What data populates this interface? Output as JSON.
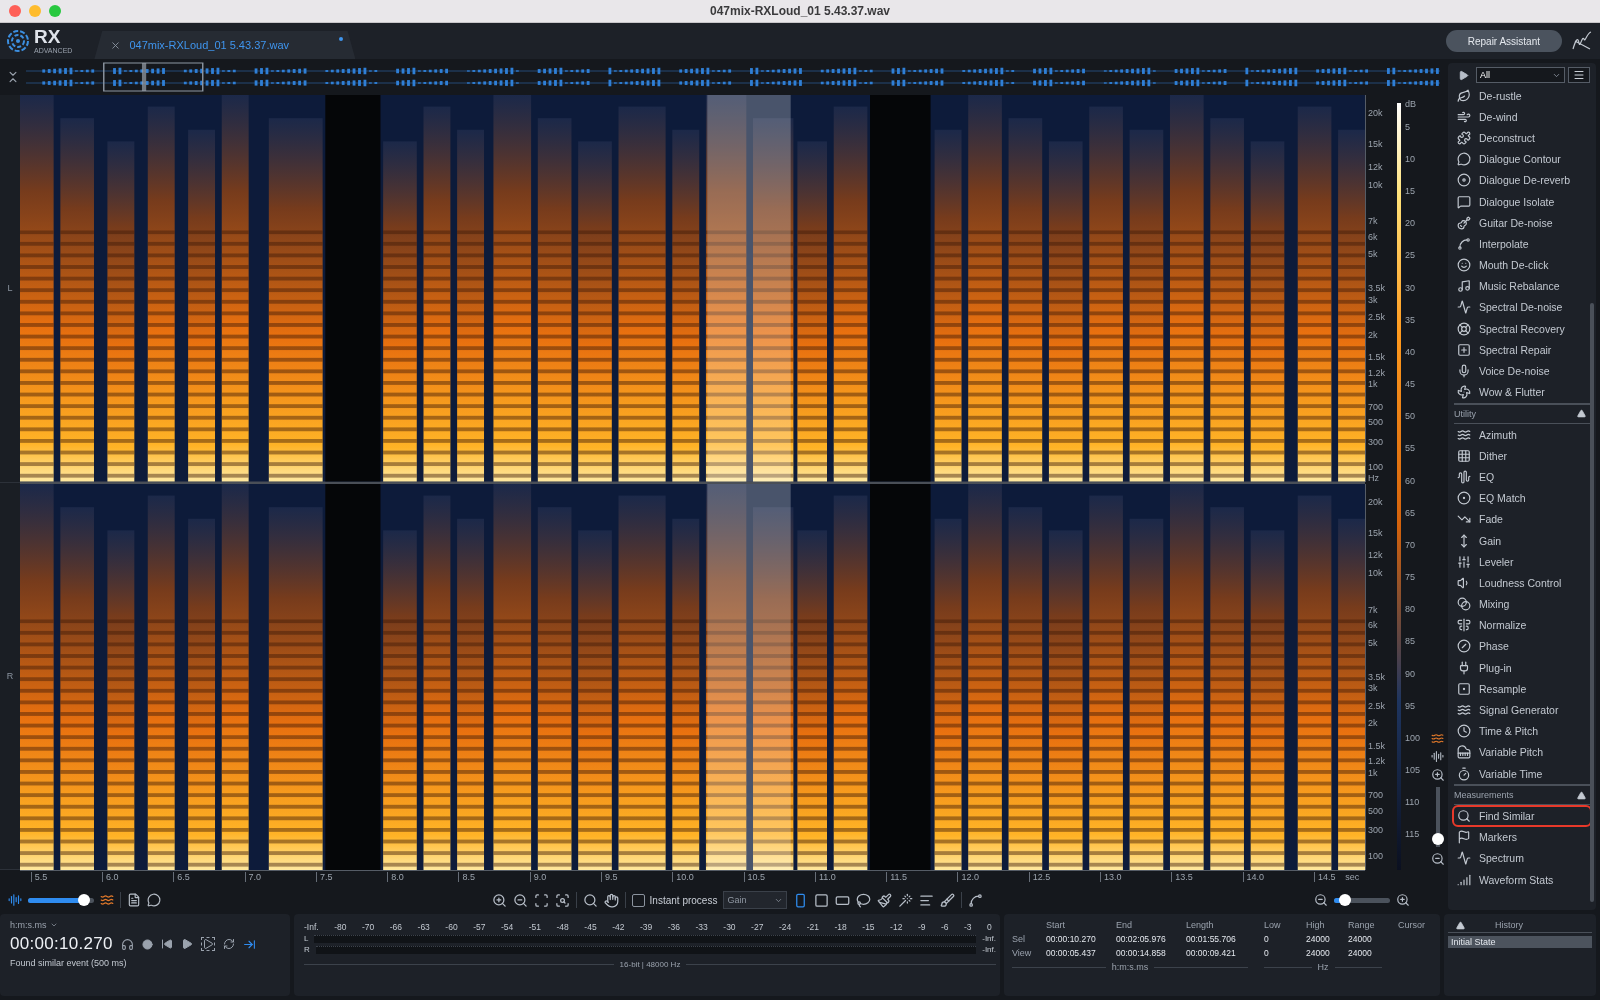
{
  "window": {
    "title": "047mix-RXLoud_01 5.43.37.wav"
  },
  "header": {
    "logo": "RX",
    "logo_sub": "ADVANCED",
    "tab": {
      "label": "047mix-RXLoud_01 5.43.37.wav",
      "modified": true
    },
    "repair_button": "Repair Assistant"
  },
  "spectrogram": {
    "channels": [
      {
        "label": "L",
        "freq_labels": [
          "20k",
          "15k",
          "12k",
          "10k",
          "7k",
          "6k",
          "5k",
          "3.5k",
          "3k",
          "2.5k",
          "2k",
          "1.5k",
          "1.2k",
          "1k",
          "700",
          "500",
          "300",
          "100",
          "Hz"
        ]
      },
      {
        "label": "R",
        "freq_labels": [
          "20k",
          "15k",
          "12k",
          "10k",
          "7k",
          "6k",
          "5k",
          "3.5k",
          "3k",
          "2.5k",
          "2k",
          "1.5k",
          "1.2k",
          "1k",
          "700",
          "500",
          "300",
          "100"
        ]
      }
    ],
    "db_labels": [
      "dB",
      "5",
      "10",
      "15",
      "20",
      "25",
      "30",
      "35",
      "40",
      "45",
      "50",
      "55",
      "60",
      "65",
      "70",
      "75",
      "80",
      "85",
      "90",
      "95",
      "100",
      "105",
      "110",
      "115"
    ],
    "time_labels": [
      "5.5",
      "6.0",
      "6.5",
      "7.0",
      "7.5",
      "8.0",
      "8.5",
      "9.0",
      "9.5",
      "10.0",
      "10.5",
      "11.0",
      "11.5",
      "12.0",
      "12.5",
      "13.0",
      "13.5",
      "14.0",
      "14.5"
    ],
    "time_unit": "sec"
  },
  "vertical_zoom": {
    "level": 0.05
  },
  "toolbar": {
    "blend": {
      "level": 0.85
    },
    "instant_process": {
      "label": "Instant process",
      "checked": false
    },
    "process": {
      "value": "Gain"
    },
    "horizontal_zoom": {
      "level": 0.2
    }
  },
  "modules": {
    "filter": "All",
    "groups": [
      {
        "items": [
          {
            "label": "De-rustle",
            "highlighted": false
          },
          {
            "label": "De-wind",
            "highlighted": false
          },
          {
            "label": "Deconstruct",
            "highlighted": false
          },
          {
            "label": "Dialogue Contour",
            "highlighted": false
          },
          {
            "label": "Dialogue De-reverb",
            "highlighted": false
          },
          {
            "label": "Dialogue Isolate",
            "highlighted": false
          },
          {
            "label": "Guitar De-noise",
            "highlighted": false
          },
          {
            "label": "Interpolate",
            "highlighted": false
          },
          {
            "label": "Mouth De-click",
            "highlighted": false
          },
          {
            "label": "Music Rebalance",
            "highlighted": false
          },
          {
            "label": "Spectral De-noise",
            "highlighted": false
          },
          {
            "label": "Spectral Recovery",
            "highlighted": false
          },
          {
            "label": "Spectral Repair",
            "highlighted": false
          },
          {
            "label": "Voice De-noise",
            "highlighted": false
          },
          {
            "label": "Wow & Flutter",
            "highlighted": false
          }
        ]
      },
      {
        "title": "Utility",
        "expanded": true,
        "items": [
          {
            "label": "Azimuth",
            "highlighted": false
          },
          {
            "label": "Dither",
            "highlighted": false
          },
          {
            "label": "EQ",
            "highlighted": false
          },
          {
            "label": "EQ Match",
            "highlighted": false
          },
          {
            "label": "Fade",
            "highlighted": false
          },
          {
            "label": "Gain",
            "highlighted": false
          },
          {
            "label": "Leveler",
            "highlighted": false
          },
          {
            "label": "Loudness Control",
            "highlighted": false
          },
          {
            "label": "Mixing",
            "highlighted": false
          },
          {
            "label": "Normalize",
            "highlighted": false
          },
          {
            "label": "Phase",
            "highlighted": false
          },
          {
            "label": "Plug-in",
            "highlighted": false
          },
          {
            "label": "Resample",
            "highlighted": false
          },
          {
            "label": "Signal Generator",
            "highlighted": false
          },
          {
            "label": "Time & Pitch",
            "highlighted": false
          },
          {
            "label": "Variable Pitch",
            "highlighted": false
          },
          {
            "label": "Variable Time",
            "highlighted": false
          }
        ]
      },
      {
        "title": "Measurements",
        "expanded": true,
        "items": [
          {
            "label": "Find Similar",
            "highlighted": true
          },
          {
            "label": "Markers",
            "highlighted": false
          },
          {
            "label": "Spectrum",
            "highlighted": false
          },
          {
            "label": "Waveform Stats",
            "highlighted": false
          }
        ]
      }
    ]
  },
  "transport": {
    "time_format": "h:m:s.ms",
    "time": "00:00:10.270",
    "follow": {
      "on": true
    },
    "status": "Found similar event (500 ms)"
  },
  "meter": {
    "scale": [
      "-Inf.",
      "-80",
      "-70",
      "-66",
      "-63",
      "-60",
      "-57",
      "-54",
      "-51",
      "-48",
      "-45",
      "-42",
      "-39",
      "-36",
      "-33",
      "-30",
      "-27",
      "-24",
      "-21",
      "-18",
      "-15",
      "-12",
      "-9",
      "-6",
      "-3",
      "0"
    ],
    "channels": [
      {
        "label": "L",
        "peak": "-Inf."
      },
      {
        "label": "R",
        "peak": "-Inf."
      }
    ],
    "format": "16-bit | 48000 Hz"
  },
  "selection_info": {
    "time_headers": [
      "Start",
      "End",
      "Length"
    ],
    "freq_headers": [
      "Low",
      "High",
      "Range"
    ],
    "cursor_header": "Cursor",
    "rows": [
      {
        "label": "Sel",
        "times": [
          "00:00:10.270",
          "00:02:05.976",
          "00:01:55.706"
        ],
        "freqs": [
          "0",
          "24000",
          "24000"
        ]
      },
      {
        "label": "View",
        "times": [
          "00:00:05.437",
          "00:00:14.858",
          "00:00:09.421"
        ],
        "freqs": [
          "0",
          "24000",
          "24000"
        ]
      }
    ],
    "time_unit": "h:m:s.ms",
    "freq_unit": "Hz"
  },
  "history": {
    "title": "History",
    "items": [
      {
        "label": "Initial State",
        "selected": true
      }
    ]
  }
}
